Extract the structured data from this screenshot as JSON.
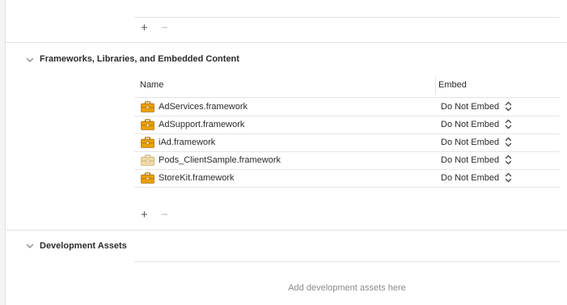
{
  "top_controls": {
    "add_label": "+",
    "remove_label": "−"
  },
  "frameworks_section": {
    "title": "Frameworks, Libraries, and Embedded Content",
    "columns": {
      "name": "Name",
      "embed": "Embed"
    },
    "rows": [
      {
        "name": "AdServices.framework",
        "embed": "Do Not Embed",
        "icon": "framework-toolbox-icon"
      },
      {
        "name": "AdSupport.framework",
        "embed": "Do Not Embed",
        "icon": "framework-toolbox-icon"
      },
      {
        "name": "iAd.framework",
        "embed": "Do Not Embed",
        "icon": "framework-toolbox-icon"
      },
      {
        "name": "Pods_ClientSample.framework",
        "embed": "Do Not Embed",
        "icon": "framework-toolbox-faded-icon"
      },
      {
        "name": "StoreKit.framework",
        "embed": "Do Not Embed",
        "icon": "framework-toolbox-icon"
      }
    ],
    "add_label": "+",
    "remove_label": "−"
  },
  "assets_section": {
    "title": "Development Assets",
    "placeholder": "Add development assets here"
  },
  "colors": {
    "toolbox": "#e8a10a",
    "toolbox_faded": "#efd9a6"
  }
}
